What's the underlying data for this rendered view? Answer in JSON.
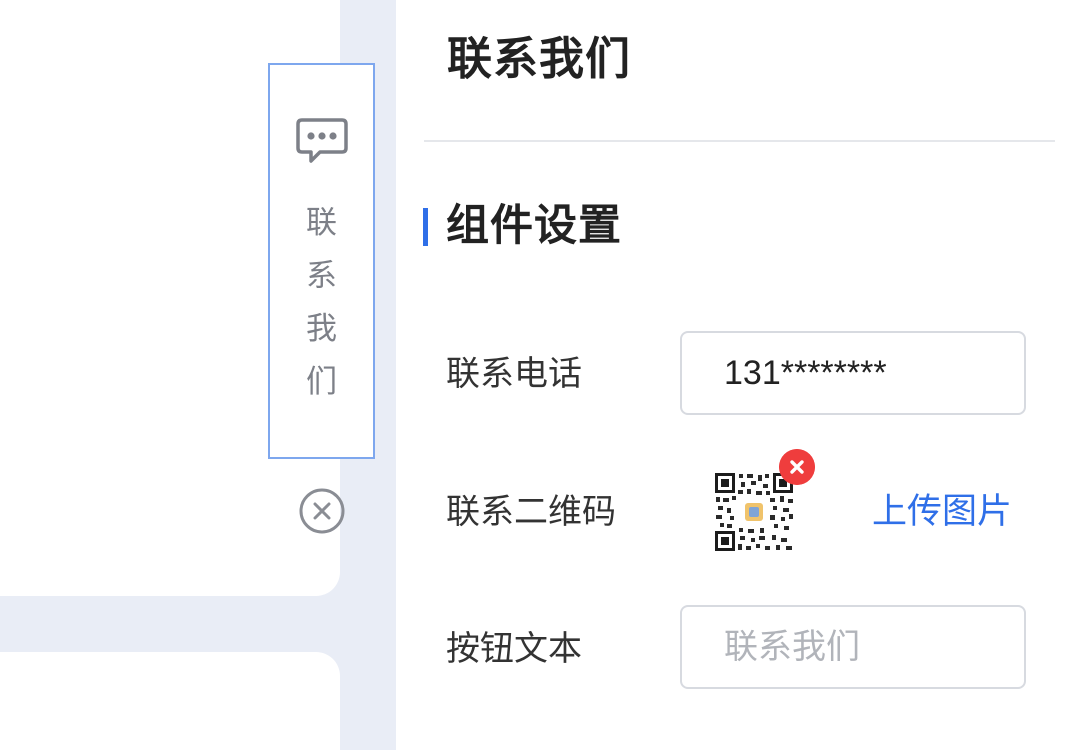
{
  "widget": {
    "label_chars": [
      "联",
      "系",
      "我",
      "们"
    ],
    "icon": "chat-bubble-icon",
    "close_icon": "close-circle-icon"
  },
  "panel": {
    "title": "联系我们",
    "section": {
      "title": "组件设置",
      "accent_color": "#2f6fe8"
    },
    "fields": {
      "phone": {
        "label": "联系电话",
        "value": "131********"
      },
      "qrcode": {
        "label": "联系二维码",
        "remove_icon": "close-badge-icon",
        "upload_label": "上传图片"
      },
      "button_text": {
        "label": "按钮文本",
        "placeholder": "联系我们"
      }
    }
  },
  "colors": {
    "accent": "#2f6fe8",
    "danger": "#ef3d3d",
    "canvas_bg": "#e9edf6",
    "selection_border": "#7ea7ee"
  }
}
